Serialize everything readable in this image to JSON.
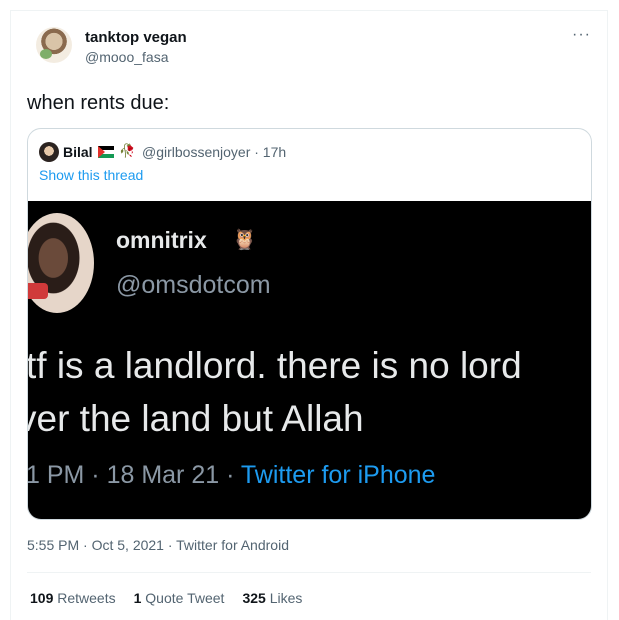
{
  "author": {
    "display_name": "tanktop vegan",
    "handle": "@mooo_fasa"
  },
  "more_icon": "···",
  "tweet_text": "when rents due:",
  "quote": {
    "name": "Bilal",
    "handle_time": "@girlbossenjoyer · 17h",
    "show_thread": "Show this thread",
    "flag_icon": "palestine-flag-icon",
    "rose_icon": "rose-icon",
    "media": {
      "name": "omnitrix",
      "owl_icon": "owl-emoji-icon",
      "handle": "@omsdotcom",
      "line1": "tf is a landlord. there is no lord",
      "line2": "ver the land but Allah",
      "meta_prefix": "1 PM · 18 Mar 21 · ",
      "meta_source": "Twitter for iPhone"
    }
  },
  "timestamp": "5:55 PM · Oct 5, 2021 · Twitter for Android",
  "stats": {
    "retweets_count": "109",
    "retweets_label": "Retweets",
    "quotes_count": "1",
    "quotes_label": "Quote Tweet",
    "likes_count": "325",
    "likes_label": "Likes"
  }
}
